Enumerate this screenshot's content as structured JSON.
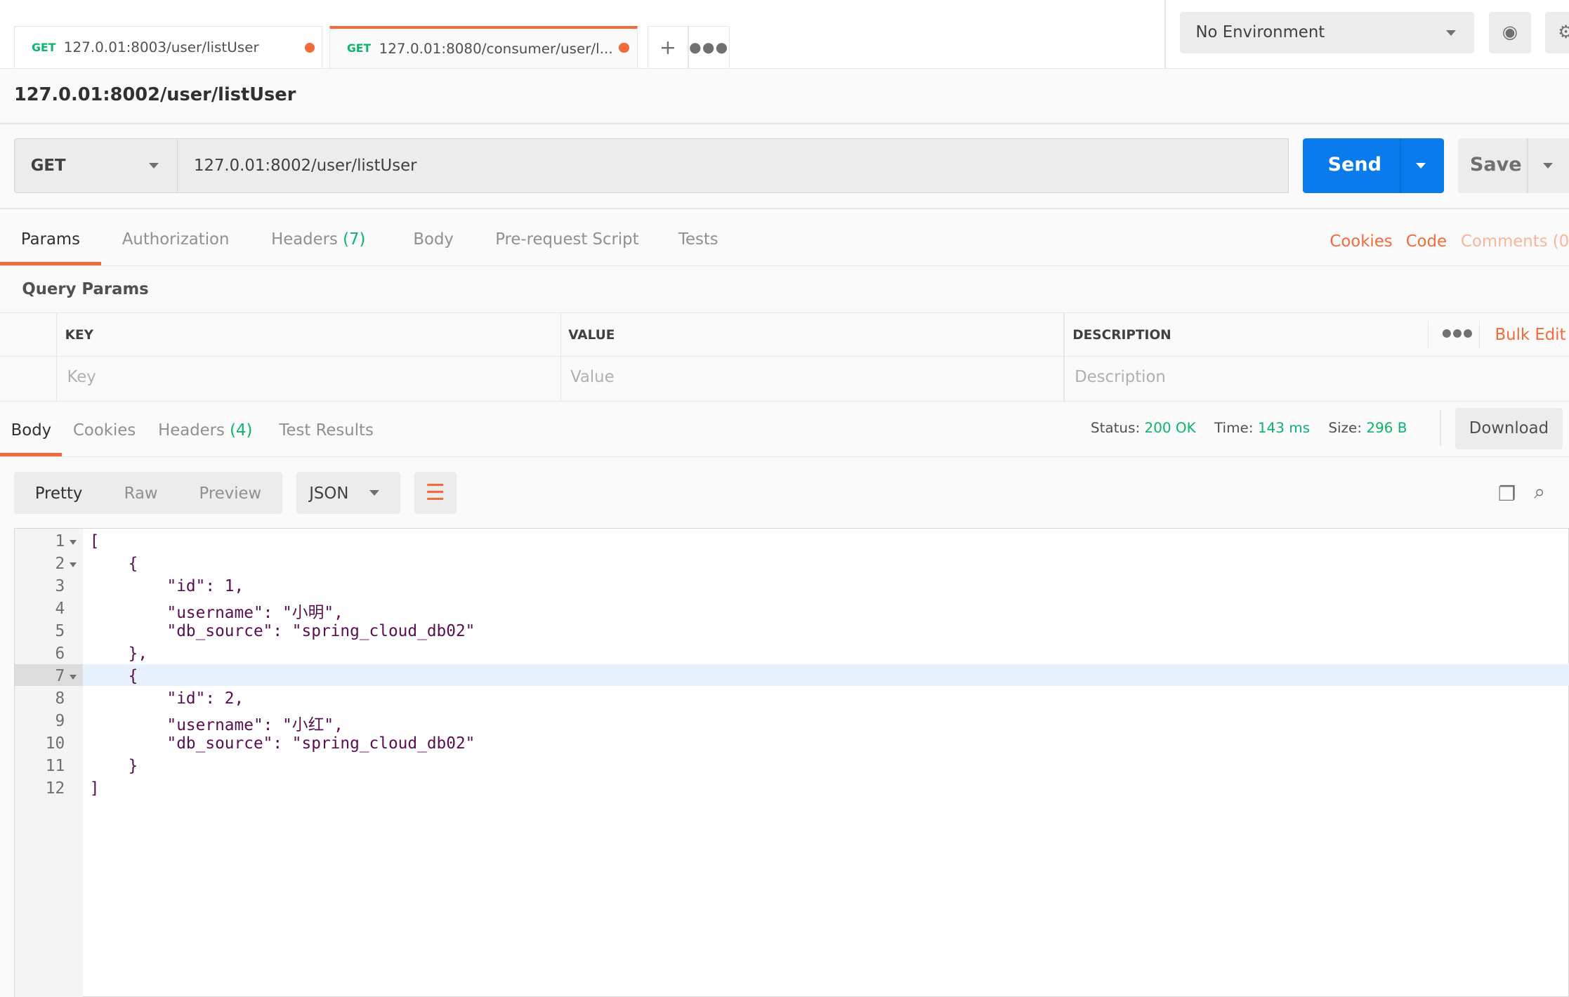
{
  "tabs": [
    {
      "method": "GET",
      "label": "127.0.01:8003/user/listUser",
      "unsaved": true,
      "active": false
    },
    {
      "method": "GET",
      "label": "127.0.01:8080/consumer/user/l...",
      "unsaved": true,
      "active": true
    }
  ],
  "environment": {
    "selected": "No Environment"
  },
  "request": {
    "title": "127.0.01:8002/user/listUser",
    "method": "GET",
    "url": "127.0.01:8002/user/listUser",
    "send_label": "Send",
    "save_label": "Save"
  },
  "request_tabs": [
    {
      "label": "Params",
      "active": true
    },
    {
      "label": "Authorization"
    },
    {
      "label": "Headers",
      "count": "(7)"
    },
    {
      "label": "Body"
    },
    {
      "label": "Pre-request Script"
    },
    {
      "label": "Tests"
    }
  ],
  "request_links": {
    "cookies": "Cookies",
    "code": "Code",
    "comments": "Comments (0)"
  },
  "query_params": {
    "title": "Query Params",
    "columns": [
      "KEY",
      "VALUE",
      "DESCRIPTION"
    ],
    "bulk_edit": "Bulk Edit",
    "placeholders": [
      "Key",
      "Value",
      "Description"
    ]
  },
  "response_tabs": [
    {
      "label": "Body",
      "active": true
    },
    {
      "label": "Cookies"
    },
    {
      "label": "Headers",
      "count": "(4)"
    },
    {
      "label": "Test Results"
    }
  ],
  "response_status": {
    "status_label": "Status:",
    "status": "200 OK",
    "time_label": "Time:",
    "time": "143 ms",
    "size_label": "Size:",
    "size": "296 B",
    "download": "Download"
  },
  "view_modes": [
    "Pretty",
    "Raw",
    "Preview"
  ],
  "format": "JSON",
  "colors": {
    "accent": "#f26b3a",
    "send": "#097bed",
    "success": "#0cb46c"
  },
  "code_lines": [
    "[",
    "    {",
    "        \"id\": 1,",
    "        \"username\": \"小明\",",
    "        \"db_source\": \"spring_cloud_db02\"",
    "    },",
    "    {",
    "        \"id\": 2,",
    "        \"username\": \"小红\",",
    "        \"db_source\": \"spring_cloud_db02\"",
    "    }",
    "]"
  ],
  "line_numbers": [
    "1",
    "2",
    "3",
    "4",
    "5",
    "6",
    "7",
    "8",
    "9",
    "10",
    "11",
    "12"
  ]
}
